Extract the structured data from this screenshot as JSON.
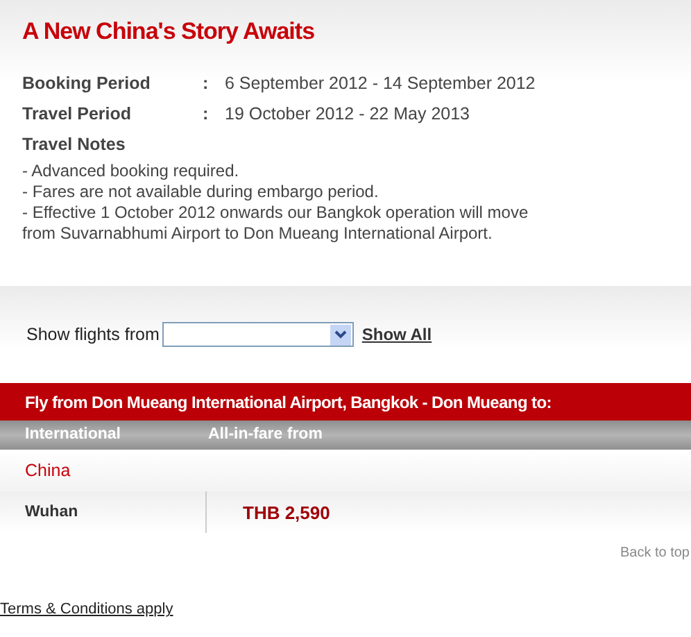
{
  "title": "A New China's Story Awaits",
  "details": [
    {
      "label": "Booking Period",
      "separator": ":",
      "value": "6 September 2012 - 14 September 2012"
    },
    {
      "label": "Travel Period",
      "separator": ":",
      "value": "19 October 2012 - 22 May 2013"
    }
  ],
  "notes": {
    "heading": "Travel Notes",
    "lines": [
      "- Advanced booking required.",
      "- Fares are not available during embargo period.",
      "- Effective 1 October 2012 onwards our Bangkok operation will move from Suvarnabhumi Airport to Don Mueang International Airport."
    ]
  },
  "filter": {
    "label": "Show flights from",
    "show_all": "Show All"
  },
  "routes": {
    "heading": "Fly from Don Mueang International Airport, Bangkok - Don Mueang to:",
    "columns": [
      "International",
      "All-in-fare from"
    ],
    "groups": [
      {
        "country": "China",
        "rows": [
          {
            "city": "Wuhan",
            "fare": "THB 2,590"
          }
        ]
      }
    ]
  },
  "back_to_top": "Back to top",
  "terms": "Terms & Conditions apply"
}
